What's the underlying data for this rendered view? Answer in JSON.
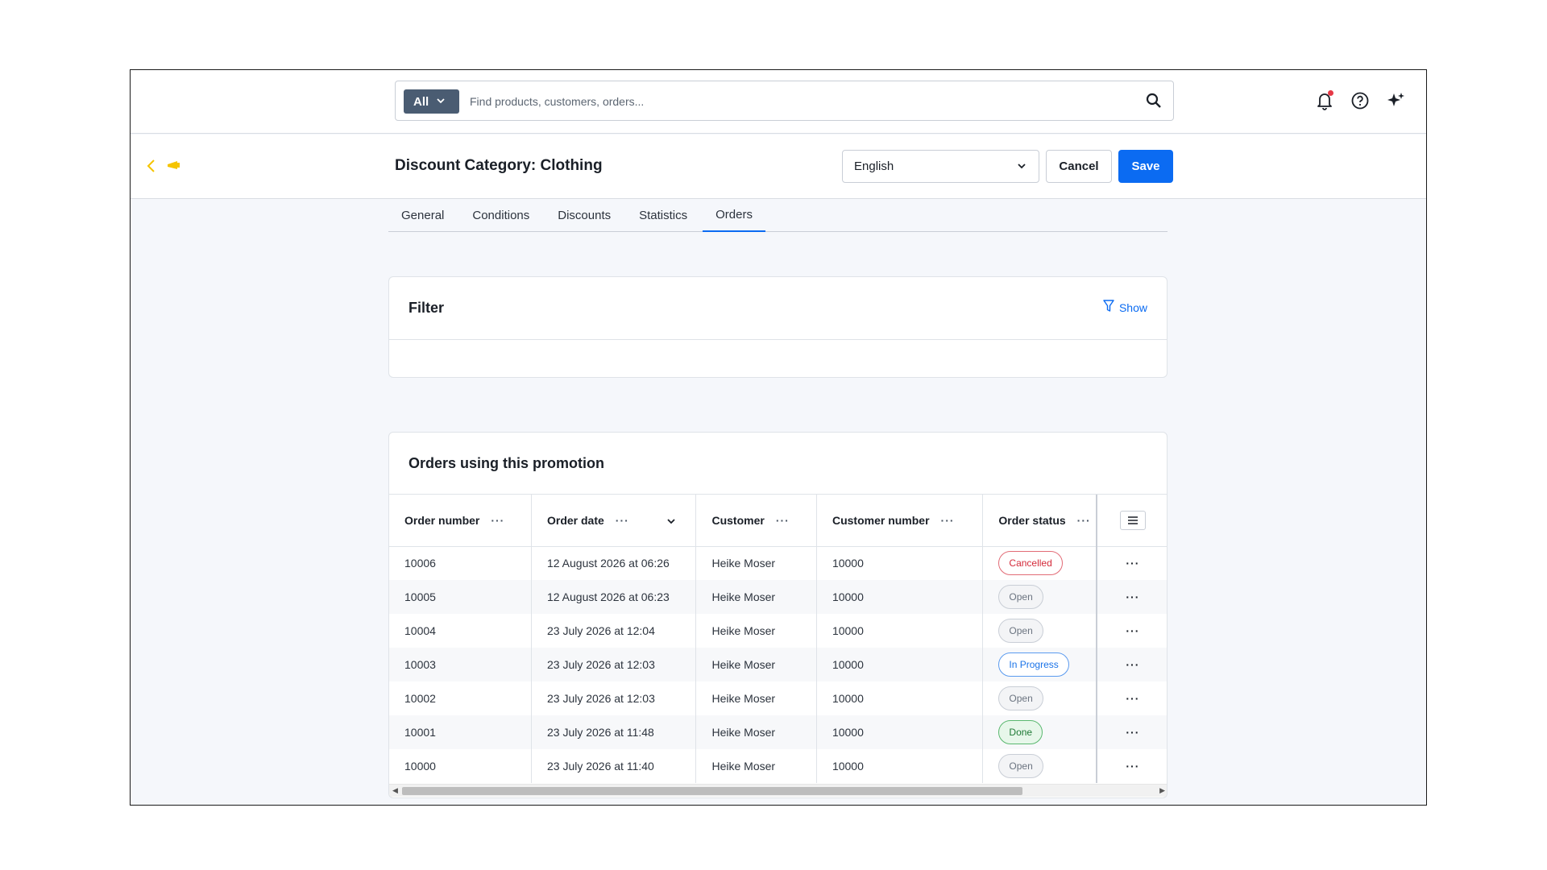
{
  "search": {
    "scope": "All",
    "placeholder": "Find products, customers, orders..."
  },
  "header": {
    "title": "Discount Category: Clothing",
    "language": "English",
    "cancel_label": "Cancel",
    "save_label": "Save"
  },
  "tabs": [
    {
      "label": "General"
    },
    {
      "label": "Conditions"
    },
    {
      "label": "Discounts"
    },
    {
      "label": "Statistics"
    },
    {
      "label": "Orders",
      "active": true
    }
  ],
  "filter": {
    "title": "Filter",
    "show_label": "Show"
  },
  "orders": {
    "title": "Orders using this promotion",
    "columns": [
      "Order number",
      "Order date",
      "Customer",
      "Customer number",
      "Order status"
    ],
    "rows": [
      {
        "number": "10006",
        "date": "12 August 2026 at 06:26",
        "customer": "Heike Moser",
        "customer_number": "10000",
        "status": "Cancelled",
        "status_kind": "cancelled"
      },
      {
        "number": "10005",
        "date": "12 August 2026 at 06:23",
        "customer": "Heike Moser",
        "customer_number": "10000",
        "status": "Open",
        "status_kind": "open"
      },
      {
        "number": "10004",
        "date": "23 July 2026 at 12:04",
        "customer": "Heike Moser",
        "customer_number": "10000",
        "status": "Open",
        "status_kind": "open"
      },
      {
        "number": "10003",
        "date": "23 July 2026 at 12:03",
        "customer": "Heike Moser",
        "customer_number": "10000",
        "status": "In Progress",
        "status_kind": "progress"
      },
      {
        "number": "10002",
        "date": "23 July 2026 at 12:03",
        "customer": "Heike Moser",
        "customer_number": "10000",
        "status": "Open",
        "status_kind": "open"
      },
      {
        "number": "10001",
        "date": "23 July 2026 at 11:48",
        "customer": "Heike Moser",
        "customer_number": "10000",
        "status": "Done",
        "status_kind": "done"
      },
      {
        "number": "10000",
        "date": "23 July 2026 at 11:40",
        "customer": "Heike Moser",
        "customer_number": "10000",
        "status": "Open",
        "status_kind": "open"
      }
    ]
  },
  "icons": {
    "search": "search-icon",
    "bell": "bell-icon",
    "help": "help-circle-icon",
    "ai": "sparkle-icon",
    "back": "chevron-left-icon",
    "promo": "megaphone-icon",
    "filter": "funnel-icon",
    "settings": "list-settings-icon"
  },
  "colors": {
    "accent": "#0b6bf2",
    "promo": "#f5c400",
    "notification": "#e53946"
  }
}
